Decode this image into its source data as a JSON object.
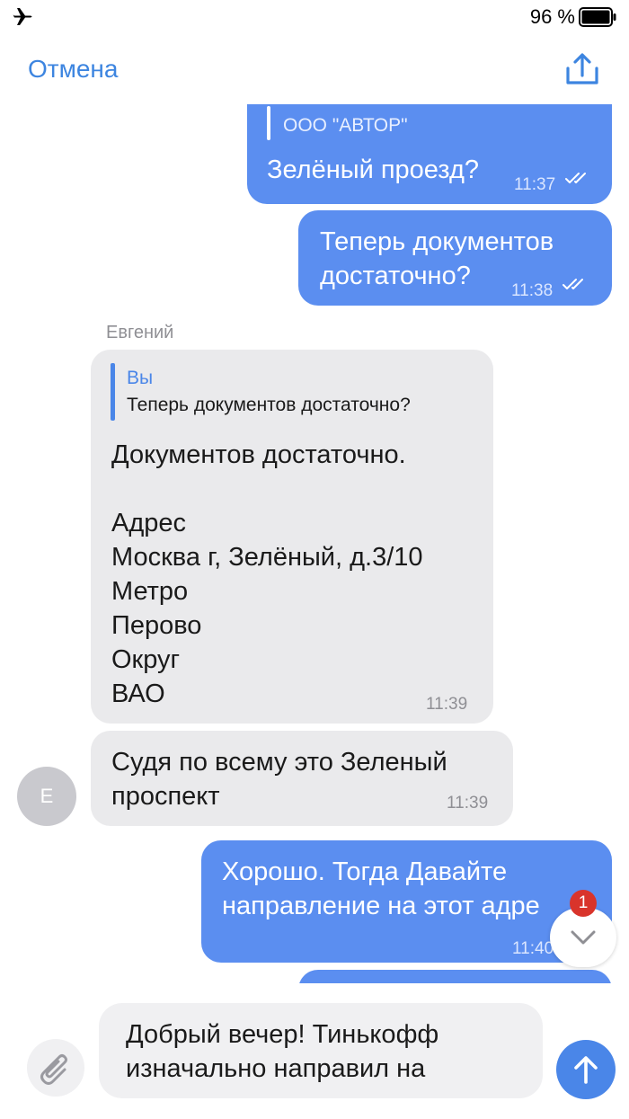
{
  "status_bar": {
    "battery": "96 %"
  },
  "nav": {
    "cancel_label": "Отмена"
  },
  "messages": [
    {
      "dir": "out",
      "quote_text": "ООО \"АВТОР\"",
      "text": "Зелёный проезд?",
      "time": "11:37"
    },
    {
      "dir": "out",
      "lines": [
        "Теперь документов",
        "достаточно?"
      ],
      "time": "11:38"
    },
    {
      "dir": "in",
      "sender": "Евгений",
      "quote_author": "Вы",
      "quote_text": "Теперь документов достаточно?",
      "lines": [
        "Документов достаточно.",
        "",
        "Адрес",
        "Москва г, Зелёный, д.3/10",
        "Метро",
        "Перово",
        "Округ",
        "ВАО"
      ],
      "time": "11:39"
    },
    {
      "dir": "in",
      "lines": [
        "Судя по всему это Зеленый",
        "проспект"
      ],
      "time": "11:39",
      "avatar_initial": "Е"
    },
    {
      "dir": "out",
      "lines": [
        "Хорошо. Тогда Давайте",
        "направление на этот адре"
      ],
      "time": "11:40"
    }
  ],
  "unread_badge": "1",
  "input": {
    "value_lines": [
      "Добрый вечер! Тинькофф",
      "изначально направил на"
    ]
  },
  "colors": {
    "accent": "#4a86e8",
    "outgoing_bubble": "#5b8ef0",
    "incoming_bubble": "#eaeaec",
    "badge": "#d9342b"
  }
}
